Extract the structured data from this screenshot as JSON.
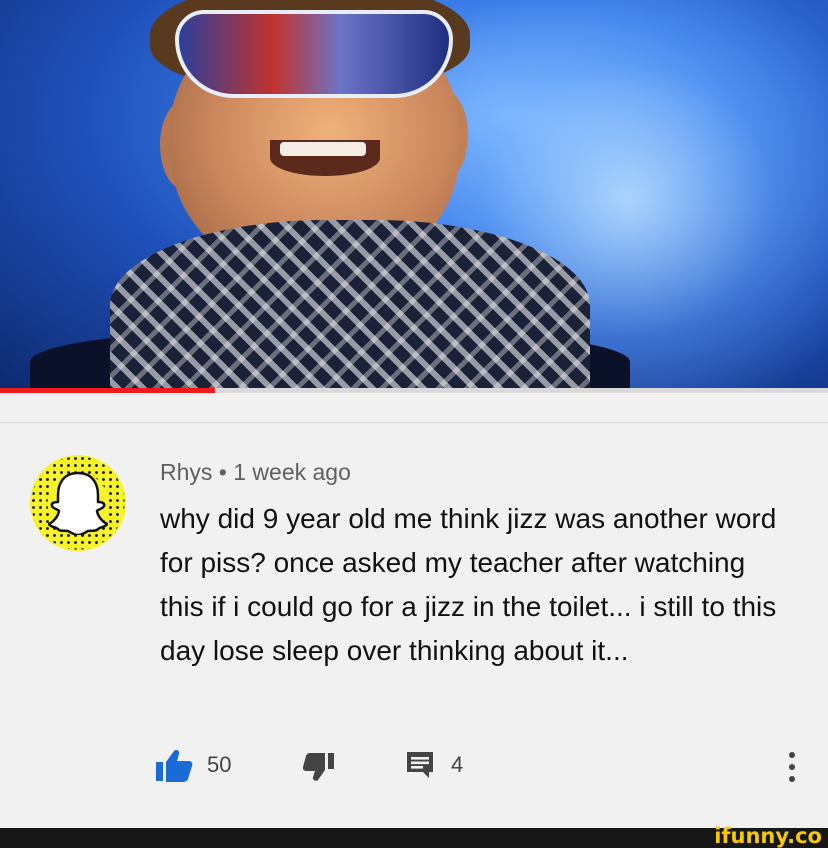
{
  "video": {
    "progress_fraction": 0.26,
    "progress_color": "#ee1c1c"
  },
  "comment": {
    "avatar_icon": "snapchat-ghost-icon",
    "author": "Rhys",
    "separator": "•",
    "time": "1 week ago",
    "text": "why did 9 year old me think jizz was another word for piss? once asked my teacher after watching this if i could go for a jizz in the toilet... i still to this day lose sleep over thinking about it..."
  },
  "actions": {
    "like_count": "50",
    "reply_count": "4",
    "accent_color": "#1a6bd6"
  },
  "footer": {
    "brand": "ifunny.co"
  }
}
